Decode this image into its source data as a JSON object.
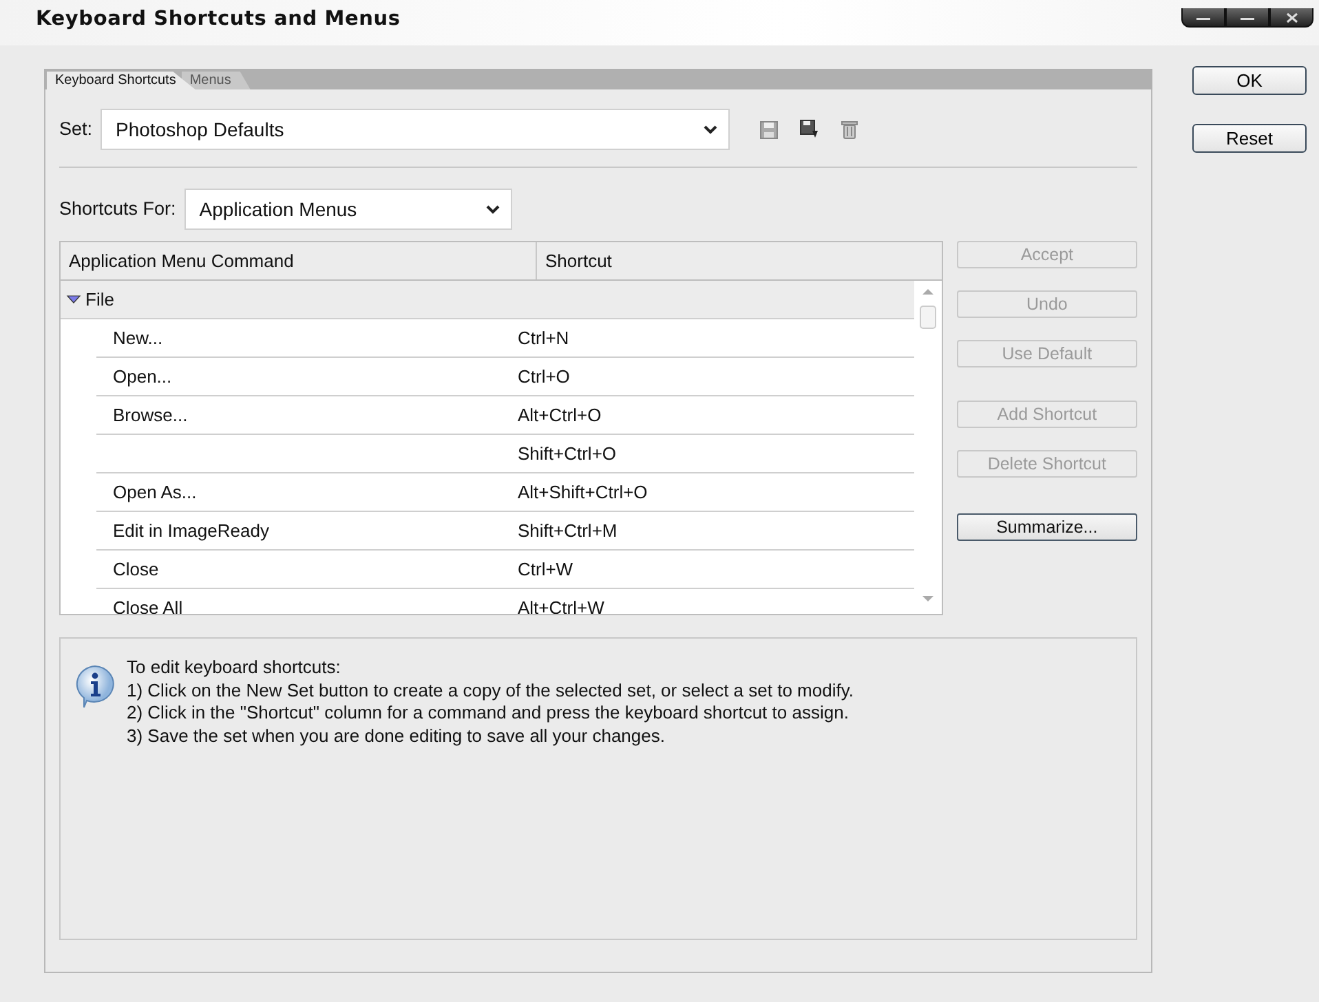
{
  "window": {
    "title": "Keyboard Shortcuts and Menus"
  },
  "tabs": [
    {
      "label": "Keyboard Shortcuts",
      "selected": true
    },
    {
      "label": "Menus",
      "selected": false
    }
  ],
  "set": {
    "label": "Set:",
    "value": "Photoshop Defaults"
  },
  "shortcuts_for": {
    "label": "Shortcuts For:",
    "value": "Application Menus"
  },
  "table": {
    "columns": [
      "Application Menu Command",
      "Shortcut"
    ],
    "groups": [
      {
        "label": "File",
        "expanded": true,
        "rows": [
          {
            "command": "New...",
            "shortcut": "Ctrl+N"
          },
          {
            "command": "Open...",
            "shortcut": "Ctrl+O"
          },
          {
            "command": "Browse...",
            "shortcut": "Alt+Ctrl+O"
          },
          {
            "command": "",
            "shortcut": "Shift+Ctrl+O"
          },
          {
            "command": "Open As...",
            "shortcut": "Alt+Shift+Ctrl+O"
          },
          {
            "command": "Edit in ImageReady",
            "shortcut": "Shift+Ctrl+M"
          },
          {
            "command": "Close",
            "shortcut": "Ctrl+W"
          },
          {
            "command": "Close All",
            "shortcut": "Alt+Ctrl+W"
          }
        ]
      }
    ]
  },
  "side_buttons": [
    {
      "label": "Accept",
      "disabled": true
    },
    {
      "label": "Undo",
      "disabled": true
    },
    {
      "label": "Use Default",
      "disabled": true
    },
    {
      "label": "Add Shortcut",
      "disabled": true
    },
    {
      "label": "Delete Shortcut",
      "disabled": true
    },
    {
      "label": "Summarize...",
      "disabled": false
    }
  ],
  "dialog_buttons": [
    {
      "label": "OK"
    },
    {
      "label": "Reset"
    }
  ],
  "info": {
    "heading": "To edit keyboard shortcuts:",
    "lines": [
      "1) Click on the New Set button to create a copy of the selected set, or select a set to modify.",
      "2) Click in the \"Shortcut\" column for a command and press the keyboard shortcut to assign.",
      "3) Save the set when you are done editing to save all your changes."
    ]
  }
}
